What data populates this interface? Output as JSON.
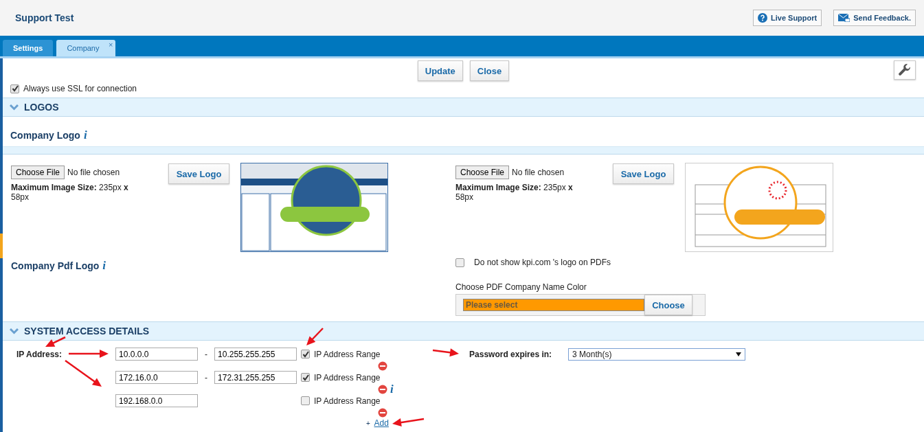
{
  "header": {
    "title": "Support Test",
    "buttons": [
      {
        "label": "Live Support",
        "kind": "help"
      },
      {
        "label": "Send Feedback.",
        "kind": "mail"
      }
    ]
  },
  "tabs": [
    {
      "label": "Settings",
      "selected": false
    },
    {
      "label": "Company",
      "selected": true,
      "close_glyph": "×"
    }
  ],
  "toolbar": {
    "buttons": [
      "Update",
      "Close"
    ]
  },
  "ssl_option": {
    "label": "Always use SSL for connection",
    "checked": true
  },
  "logos_section": {
    "title": "LOGOS",
    "expanded": true,
    "company_logo_label": "Company Logo",
    "company_logo_info": "i",
    "pdf_logo_label": "Company Pdf Logo",
    "pdf_logo_info": "i",
    "uploaders": [
      {
        "button": "Choose File",
        "status": "No file chosen",
        "size_text": "**Maximum Image Size:** 235px **x** 58px",
        "save_button": "Save Logo"
      },
      {
        "button": "Choose File",
        "status": "No file chosen",
        "size_text": "**Maximum Image Size:** 235px **x** 58px",
        "save_button": "Save Logo"
      }
    ],
    "hide_logo_option": {
      "label": "Do not show kpi.com 's logo on PDFs",
      "checked": false
    },
    "color_picker": {
      "label": "Choose PDF Company Name Color",
      "placeholder": "Please select",
      "color": "#ff9900",
      "button": "Choose"
    }
  },
  "system_access": {
    "title": "SYSTEM ACCESS DETAILS",
    "expanded": true,
    "ip_label": "IP Address:",
    "ip_rows": [
      {
        "from": "10.0.0.0",
        "separator": "-",
        "to": "10.255.255.255",
        "range_label": "IP Address Range",
        "range": true
      },
      {
        "from": "172.16.0.0",
        "separator": "-",
        "to": "172.31.255.255",
        "range_label": "IP Address Range",
        "range": true,
        "info": "i"
      },
      {
        "from": "192.168.0.0",
        "range_label": "IP Address Range",
        "range": false
      }
    ],
    "add_prefix": "+",
    "add_link": "Add",
    "password": {
      "label": "Password expires in:",
      "value": "3 Month(s)"
    }
  }
}
